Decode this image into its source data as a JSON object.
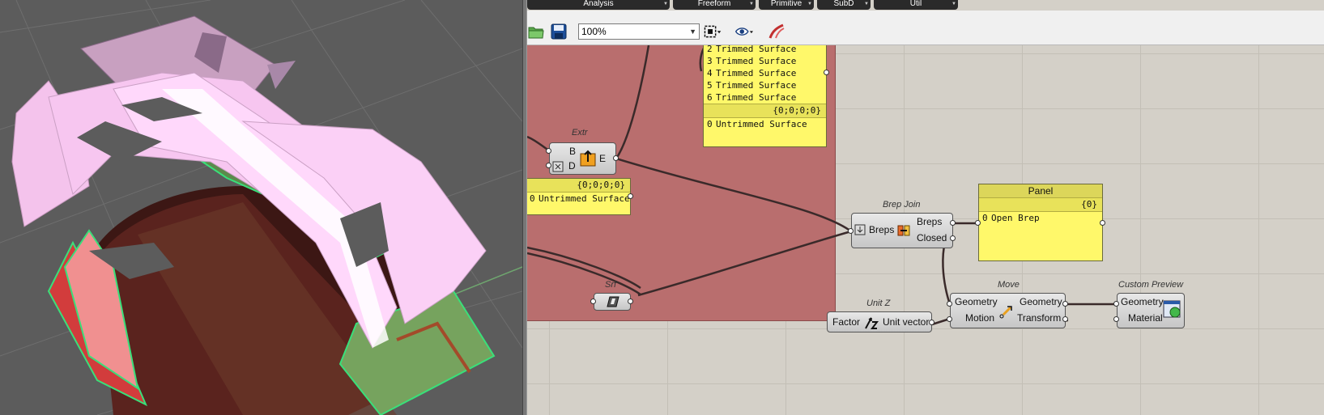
{
  "tabs": [
    "Analysis",
    "Freeform",
    "Primitive",
    "SubD",
    "Util"
  ],
  "toolbar": {
    "open_icon": "folder-icon",
    "save_icon": "floppy-disk-icon",
    "zoom": "100%",
    "zoom_extents_icon": "zoom-extents-icon",
    "preview_icon": "eye-icon",
    "sketch_icon": "pen-icon"
  },
  "canvas": {
    "panel_top": {
      "rows": [
        {
          "index": "2",
          "text": "Trimmed Surface"
        },
        {
          "index": "3",
          "text": "Trimmed Surface"
        },
        {
          "index": "4",
          "text": "Trimmed Surface"
        },
        {
          "index": "5",
          "text": "Trimmed Surface"
        },
        {
          "index": "6",
          "text": "Trimmed Surface"
        }
      ],
      "path": "{0;0;0;0}",
      "row2": {
        "index": "0",
        "text": "Untrimmed Surface"
      }
    },
    "panel_left": {
      "path": "{0;0;0;0}",
      "row": {
        "index": "0",
        "text": "Untrimmed Surface"
      }
    },
    "extr": {
      "label": "Extr",
      "in1": "B",
      "in2": "D",
      "out": "E"
    },
    "srf": {
      "label": "Srf"
    },
    "brep_join": {
      "label": "Brep Join",
      "input": "Breps",
      "out1": "Breps",
      "out2": "Closed"
    },
    "panel": {
      "title": "Panel",
      "path": "{0}",
      "row": {
        "index": "0",
        "text": "Open Brep"
      }
    },
    "unit_z": {
      "label": "Unit Z",
      "input": "Factor",
      "output": "Unit vector"
    },
    "move": {
      "label": "Move",
      "in1": "Geometry",
      "in2": "Motion",
      "out1": "Geometry",
      "out2": "Transform"
    },
    "custom_preview": {
      "label": "Custom Preview",
      "in1": "Geometry",
      "in2": "Material"
    }
  },
  "colors": {
    "group": "#b96e6e",
    "panel": "#fff86a",
    "viewport_bg": "#5c5c5c",
    "surface_pink": "#f7c6f0",
    "edge_green": "#39e07a"
  }
}
